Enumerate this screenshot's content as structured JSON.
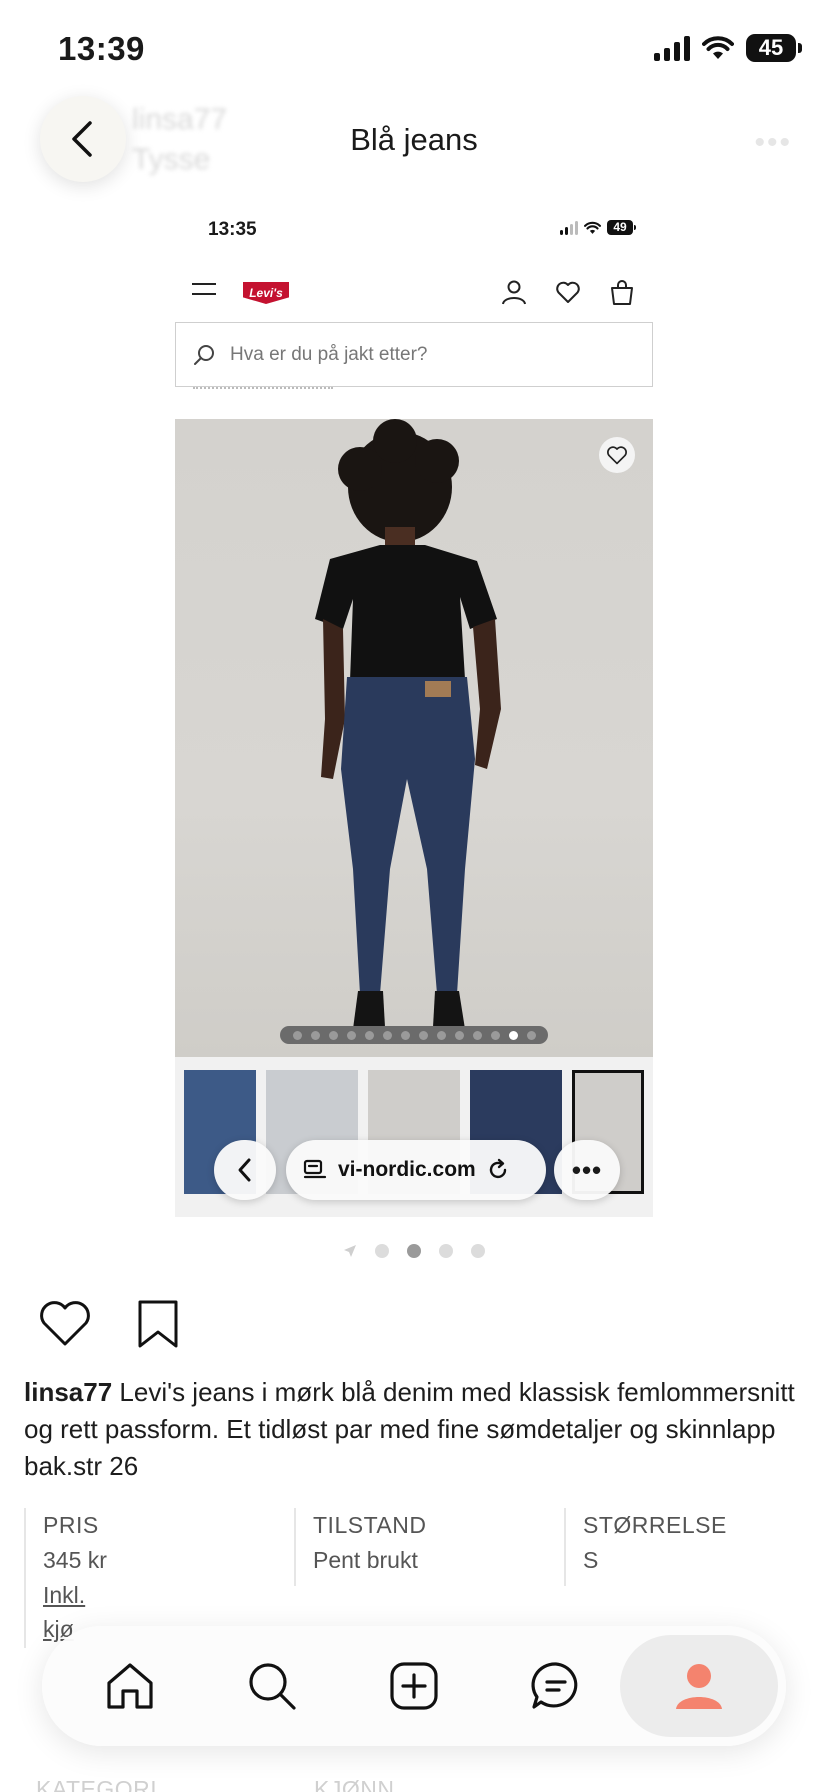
{
  "status_bar": {
    "time": "13:39",
    "battery": "45"
  },
  "header": {
    "title": "Blå jeans",
    "ghost_user": "linsa77",
    "ghost_location": "Tysse"
  },
  "embedded_screen": {
    "time": "13:35",
    "battery": "49",
    "brand_logo": "Levi's",
    "search_placeholder": "Hva er du på jakt etter?",
    "image_dots_total": 14,
    "image_dots_active": 13,
    "browser_url": "vi-nordic.com"
  },
  "carousel": {
    "pages": 4,
    "active": 2
  },
  "post": {
    "username": "linsa77",
    "caption": "Levi's jeans i mørk blå denim med klassisk femlommersnitt og rett passform. Et tidløst par med fine sømdetaljer og skinnlapp bak.str 26"
  },
  "details": {
    "price_label": "PRIS",
    "price_value": "345 kr",
    "price_note": "Inkl.",
    "price_note_cut": "kjø",
    "condition_label": "TILSTAND",
    "condition_value": "Pent brukt",
    "size_label": "STØRRELSE",
    "size_value": "S",
    "category_label": "KATEGORI",
    "gender_label": "KJØNN"
  },
  "nav": {
    "items": [
      "home-icon",
      "search-icon",
      "add-icon",
      "messages-icon",
      "profile-icon"
    ],
    "active": "profile",
    "accent": "#f4836e"
  }
}
